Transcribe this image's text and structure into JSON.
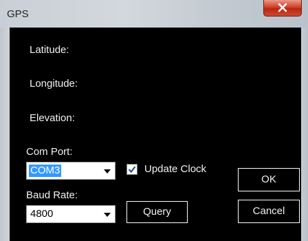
{
  "window": {
    "title": "GPS",
    "close_icon": "close-icon"
  },
  "fields": {
    "latitude_label": "Latitude:",
    "longitude_label": "Longitude:",
    "elevation_label": "Elevation:"
  },
  "com_port": {
    "label": "Com Port:",
    "value": "COM3"
  },
  "update_clock": {
    "label": "Update Clock",
    "checked": true
  },
  "baud_rate": {
    "label": "Baud Rate:",
    "value": "4800"
  },
  "buttons": {
    "query": "Query",
    "ok": "OK",
    "cancel": "Cancel"
  }
}
